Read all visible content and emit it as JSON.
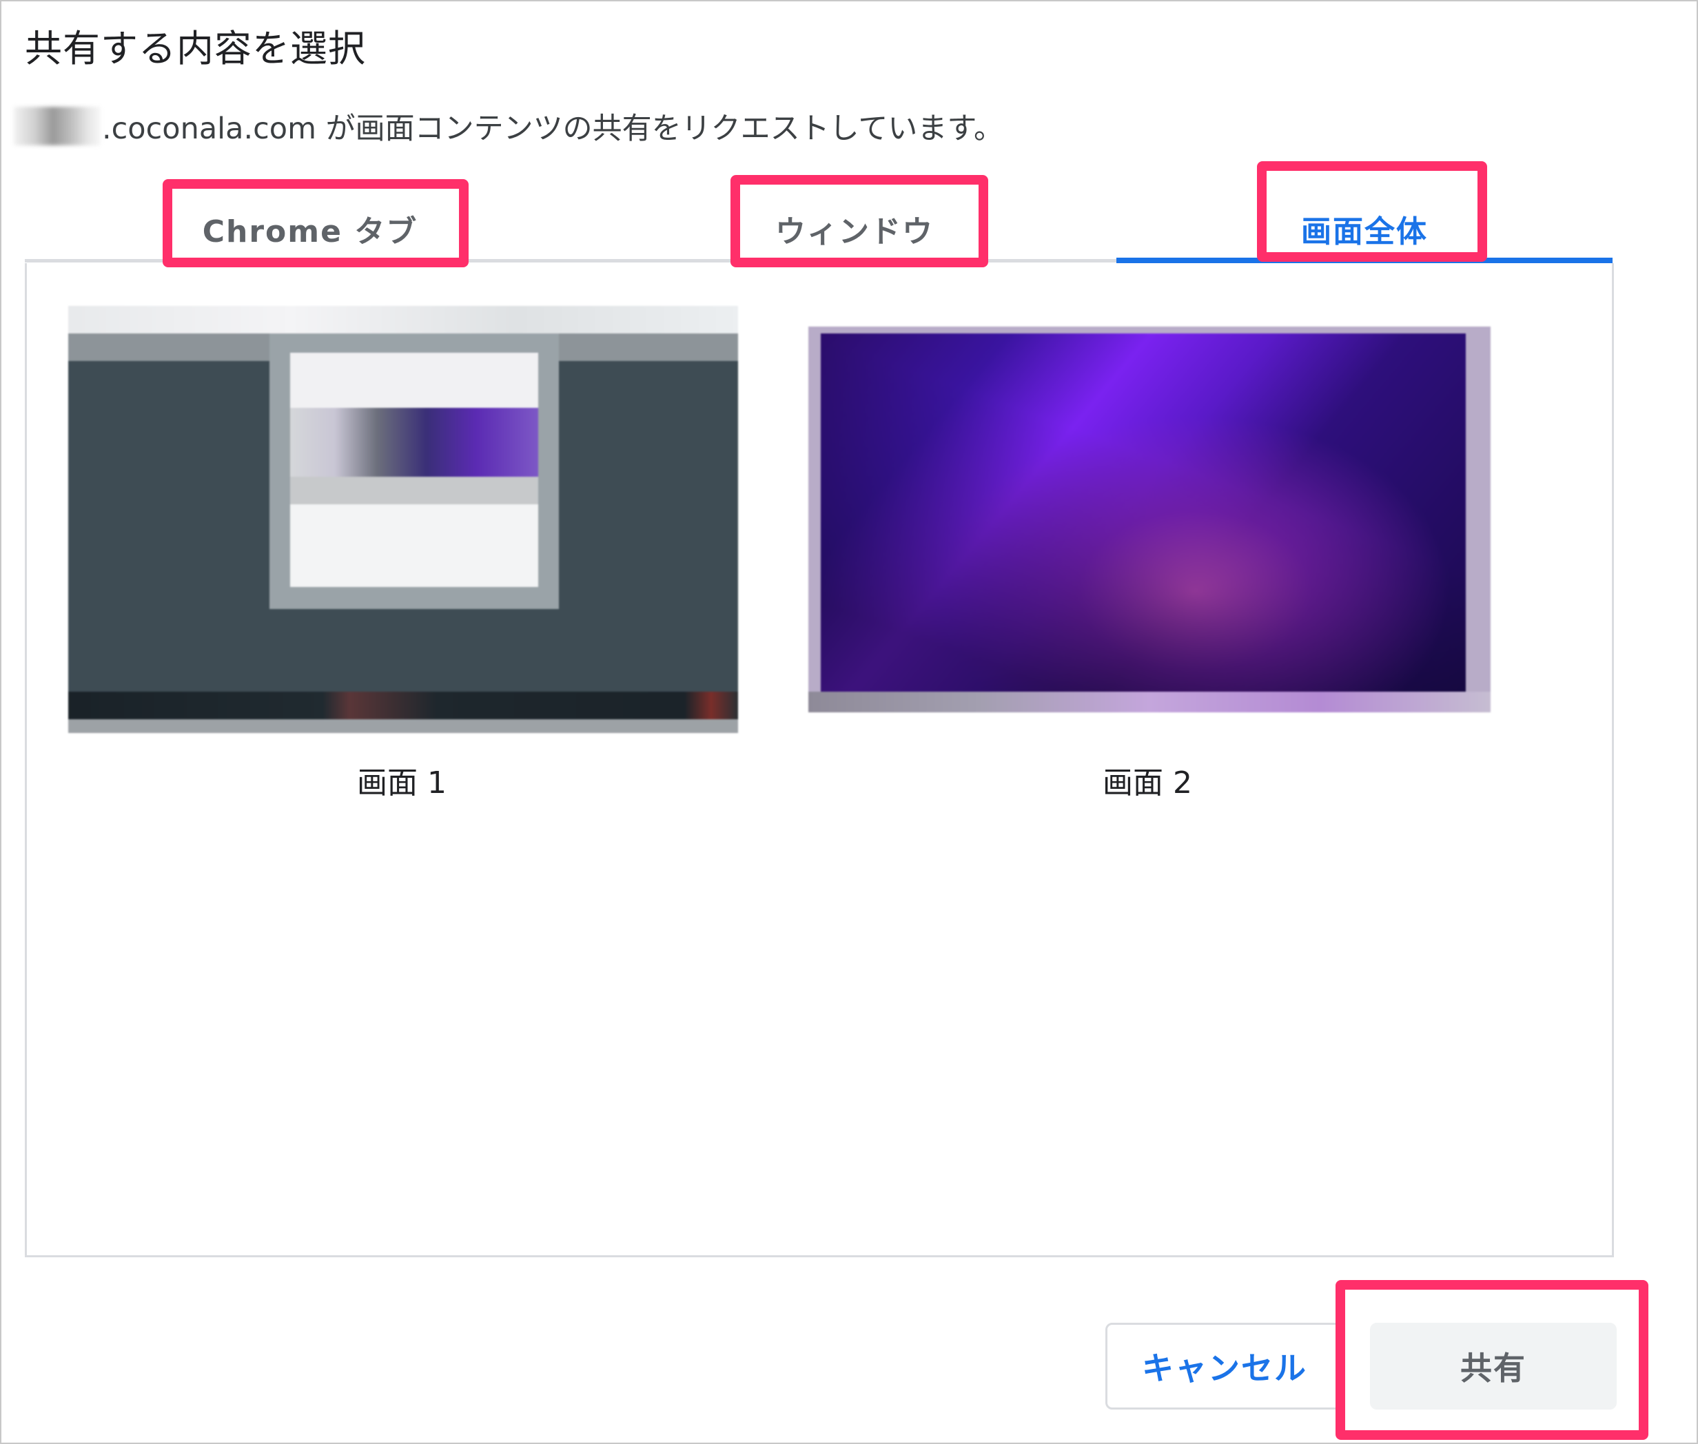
{
  "dialog": {
    "title": "共有する内容を選択",
    "request_text": ".coconala.com が画面コンテンツの共有をリクエストしています。"
  },
  "tabs": [
    {
      "label": "Chrome タブ",
      "active": false
    },
    {
      "label": "ウィンドウ",
      "active": false
    },
    {
      "label": "画面全体",
      "active": true
    }
  ],
  "screens": [
    {
      "label": "画面 1"
    },
    {
      "label": "画面 2"
    }
  ],
  "buttons": {
    "cancel_label": "キャンセル",
    "share_label": "共有"
  },
  "colors": {
    "accent": "#1a73e8",
    "highlight": "#ff2f6a",
    "tab_inactive": "#5f6368"
  }
}
